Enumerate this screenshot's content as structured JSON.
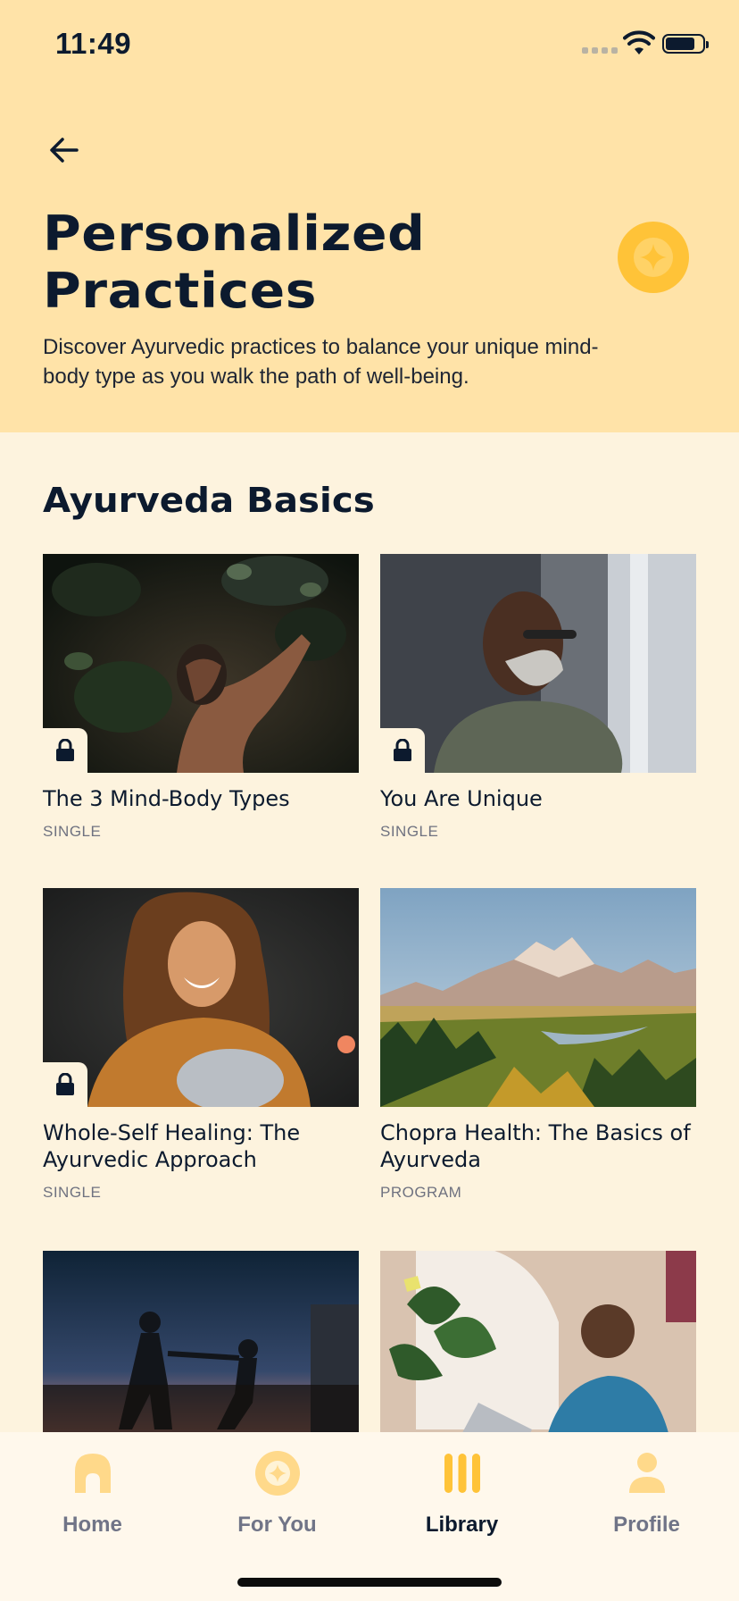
{
  "status_bar": {
    "time": "11:49"
  },
  "header": {
    "title_line1": "Personalized",
    "title_line2": "Practices",
    "subtitle": "Discover Ayurvedic practices to balance your unique mind-body type as you walk the path of well-being.",
    "back_icon": "arrow-left-icon",
    "badge_icon": "sparkle-circle-icon"
  },
  "section": {
    "title": "Ayurveda Basics",
    "cards": [
      {
        "title": "The 3 Mind-Body Types",
        "tag": "SINGLE",
        "locked": true,
        "image": "man-reaching-leaves"
      },
      {
        "title": "You Are Unique",
        "tag": "SINGLE",
        "locked": true,
        "image": "bearded-man-window"
      },
      {
        "title": "Whole-Self Healing: The Ayurvedic Approach",
        "tag": "SINGLE",
        "locked": true,
        "image": "smiling-woman-warm-light"
      },
      {
        "title": "Chopra Health: The Basics of Ayurveda",
        "tag": "PROGRAM",
        "locked": false,
        "image": "mountain-valley-landscape"
      },
      {
        "title": "",
        "tag": "",
        "locked": true,
        "image": "couple-silhouette-sunset"
      },
      {
        "title": "",
        "tag": "",
        "locked": true,
        "image": "man-laptop-plant"
      }
    ]
  },
  "tabbar": {
    "tabs": [
      {
        "label": "Home",
        "icon": "home-icon",
        "active": false
      },
      {
        "label": "For You",
        "icon": "sparkle-circle-icon",
        "active": false
      },
      {
        "label": "Library",
        "icon": "library-icon",
        "active": true
      },
      {
        "label": "Profile",
        "icon": "profile-icon",
        "active": false
      }
    ]
  },
  "colors": {
    "header_bg": "#FFE3A8",
    "page_bg": "#FDF3DE",
    "ink": "#0C1A2E",
    "accent": "#FFC338",
    "inactive_tab": "#707487"
  }
}
